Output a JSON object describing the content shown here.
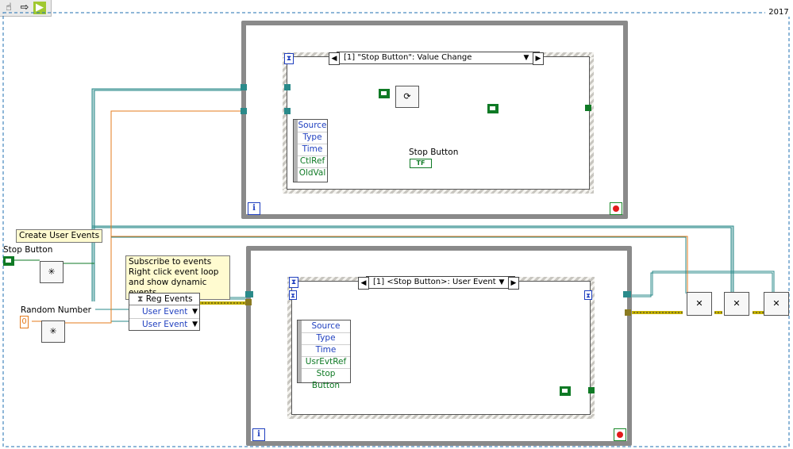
{
  "version_label": "2017",
  "toolbar": {
    "icons": [
      "hand-icon",
      "arrow-icon",
      "run-icon"
    ]
  },
  "top_loop": {
    "event_selector": "[1] \"Stop Button\": Value Change",
    "data_node": [
      "Source",
      "Type",
      "Time",
      "CtlRef",
      "OldVal"
    ],
    "control_label": "Stop Button",
    "terminal": "TF"
  },
  "bottom_loop": {
    "event_selector": "[1] <Stop Button>: User Event",
    "data_node": [
      "Source",
      "Type",
      "Time",
      "UsrEvtRef",
      "Stop Button"
    ]
  },
  "labels": {
    "create_user_events": "Create User Events",
    "stop_button": "Stop Button",
    "random_number": "Random Number",
    "subscribe_note": [
      "Subscribe to events",
      "Right click event loop",
      "and show dynamic events"
    ]
  },
  "random_number_const": "0",
  "reg_events": {
    "title": "Reg Events",
    "rows": [
      "User Event",
      "User Event"
    ]
  },
  "colors": {
    "event_wire": "#2a8a8a",
    "error_wire": "#c8b400",
    "numeric_wire": "#e57b1d",
    "boolean_wire": "#0f7a25",
    "loop_frame": "#8a8a8a"
  }
}
